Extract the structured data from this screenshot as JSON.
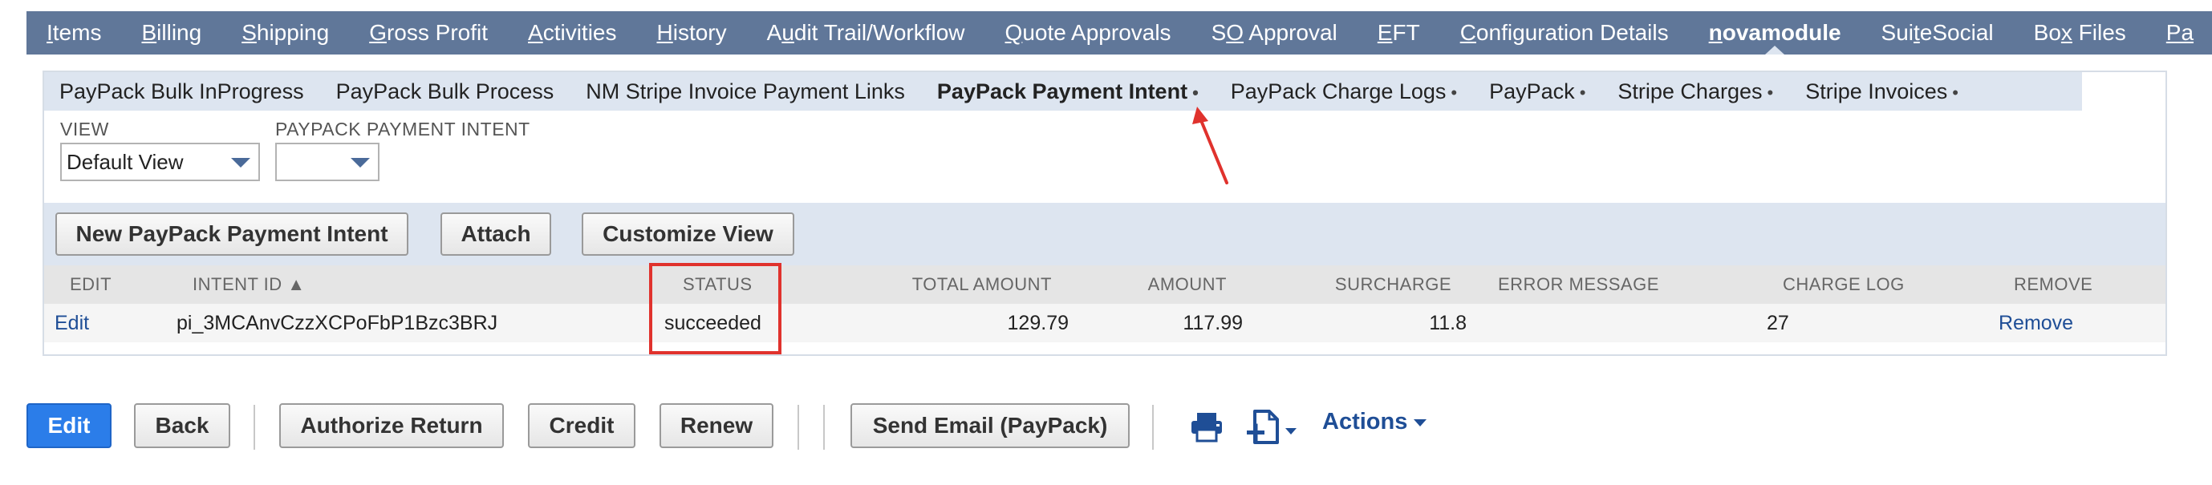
{
  "topnav": {
    "tabs": [
      {
        "pre": "",
        "ul": "I",
        "post": "tems"
      },
      {
        "pre": "",
        "ul": "B",
        "post": "illing"
      },
      {
        "pre": "",
        "ul": "S",
        "post": "hipping"
      },
      {
        "pre": "",
        "ul": "G",
        "post": "ross Profit"
      },
      {
        "pre": "",
        "ul": "A",
        "post": "ctivities"
      },
      {
        "pre": "",
        "ul": "H",
        "post": "istory"
      },
      {
        "pre": "A",
        "ul": "u",
        "post": "dit Trail/Workflow"
      },
      {
        "pre": "",
        "ul": "Q",
        "post": "uote Approvals"
      },
      {
        "pre": "S",
        "ul": "O",
        "post": " Approval"
      },
      {
        "pre": "",
        "ul": "E",
        "post": "FT"
      },
      {
        "pre": "",
        "ul": "C",
        "post": "onfiguration Details"
      },
      {
        "pre": "",
        "ul": "n",
        "post": "ovamodule"
      },
      {
        "pre": "Sui",
        "ul": "t",
        "post": "eSocial"
      },
      {
        "pre": "Bo",
        "ul": "x",
        "post": " Files"
      },
      {
        "pre": "",
        "ul": "Pa",
        "post": ""
      }
    ],
    "active_index": 11
  },
  "subtabs": {
    "items": [
      {
        "label": "PayPack Bulk InProgress",
        "dot": ""
      },
      {
        "label": "PayPack Bulk Process",
        "dot": ""
      },
      {
        "label": "NM Stripe Invoice Payment Links",
        "dot": ""
      },
      {
        "label": "PayPack Payment Intent",
        "dot": "•"
      },
      {
        "label": "PayPack Charge Logs",
        "dot": "•"
      },
      {
        "label": "PayPack",
        "dot": "•"
      },
      {
        "label": "Stripe Charges",
        "dot": "•"
      },
      {
        "label": "Stripe Invoices",
        "dot": "•"
      }
    ],
    "active_index": 3
  },
  "filters": {
    "view_label": "VIEW",
    "view_value": "Default View",
    "intent_label": "PAYPACK PAYMENT INTENT",
    "intent_value": ""
  },
  "buttons": {
    "new_intent": "New PayPack Payment Intent",
    "attach": "Attach",
    "customize_view": "Customize View"
  },
  "table": {
    "headers": {
      "edit": "EDIT",
      "intent_id": "INTENT ID ▲",
      "status": "STATUS",
      "total_amount": "TOTAL AMOUNT",
      "amount": "AMOUNT",
      "surcharge": "SURCHARGE",
      "error_message": "ERROR MESSAGE",
      "charge_log": "CHARGE LOG",
      "remove": "REMOVE"
    },
    "rows": [
      {
        "edit": "Edit",
        "intent_id": "pi_3MCAnvCzzXCPoFbP1Bzc3BRJ",
        "status": "succeeded",
        "total_amount": "129.79",
        "amount": "117.99",
        "surcharge": "11.8",
        "error_message": "",
        "charge_log": "27",
        "remove": "Remove"
      }
    ]
  },
  "toolbar": {
    "edit": "Edit",
    "back": "Back",
    "authorize_return": "Authorize Return",
    "credit": "Credit",
    "renew": "Renew",
    "send_email": "Send Email (PayPack)",
    "actions": "Actions"
  },
  "colors": {
    "nav_bg": "#607799",
    "subtab_bg": "#dde5f0",
    "primary_button": "#2b7de9",
    "link": "#1f4e96",
    "annotation": "#e0322d"
  },
  "icons": {
    "print": "printer-icon",
    "new_document": "new-document-icon"
  }
}
